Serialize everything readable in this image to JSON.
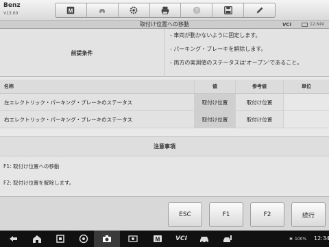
{
  "app": {
    "brand": "Benz",
    "version": "V13.00"
  },
  "toolbar": {
    "buttons": [
      {
        "icon": "home-icon"
      },
      {
        "icon": "swap-vehicle-icon"
      },
      {
        "icon": "gear-icon"
      },
      {
        "icon": "printer-icon"
      },
      {
        "icon": "help-icon"
      },
      {
        "icon": "save-icon"
      },
      {
        "icon": "pencil-icon"
      }
    ]
  },
  "titlebar": {
    "title": "取付け位置への移動",
    "vci": "VCI",
    "voltage": "12.64V"
  },
  "preconditions": {
    "label": "前提条件",
    "items": [
      "- 車両が動かないように固定します。",
      "- パーキング・ブレーキを解除します。",
      "- 両方の実測値のステータスは'オープン'であること。"
    ]
  },
  "table": {
    "headers": {
      "name": "名称",
      "value": "値",
      "reference": "参考値",
      "unit": "単位"
    },
    "rows": [
      {
        "name": "左エレクトリック・パーキング・ブレーキのステータス",
        "value": "取付け位置",
        "reference": "取付け位置",
        "unit": ""
      },
      {
        "name": "右エレクトリック・パーキング・ブレーキのステータス",
        "value": "取付け位置",
        "reference": "取付け位置",
        "unit": ""
      }
    ]
  },
  "notes": {
    "title": "注意事項",
    "lines": [
      "F1: 取付け位置への移動",
      "F2: 取付け位置を解除します。"
    ]
  },
  "actions": {
    "esc": "ESC",
    "f1": "F1",
    "f2": "F2",
    "continue": "続行"
  },
  "navbar": {
    "vci_label": "VCI",
    "battery": "100%",
    "clock": "12:34"
  },
  "colors": {
    "accent_green": "#3c9a3c",
    "nav_background": "#111111"
  }
}
